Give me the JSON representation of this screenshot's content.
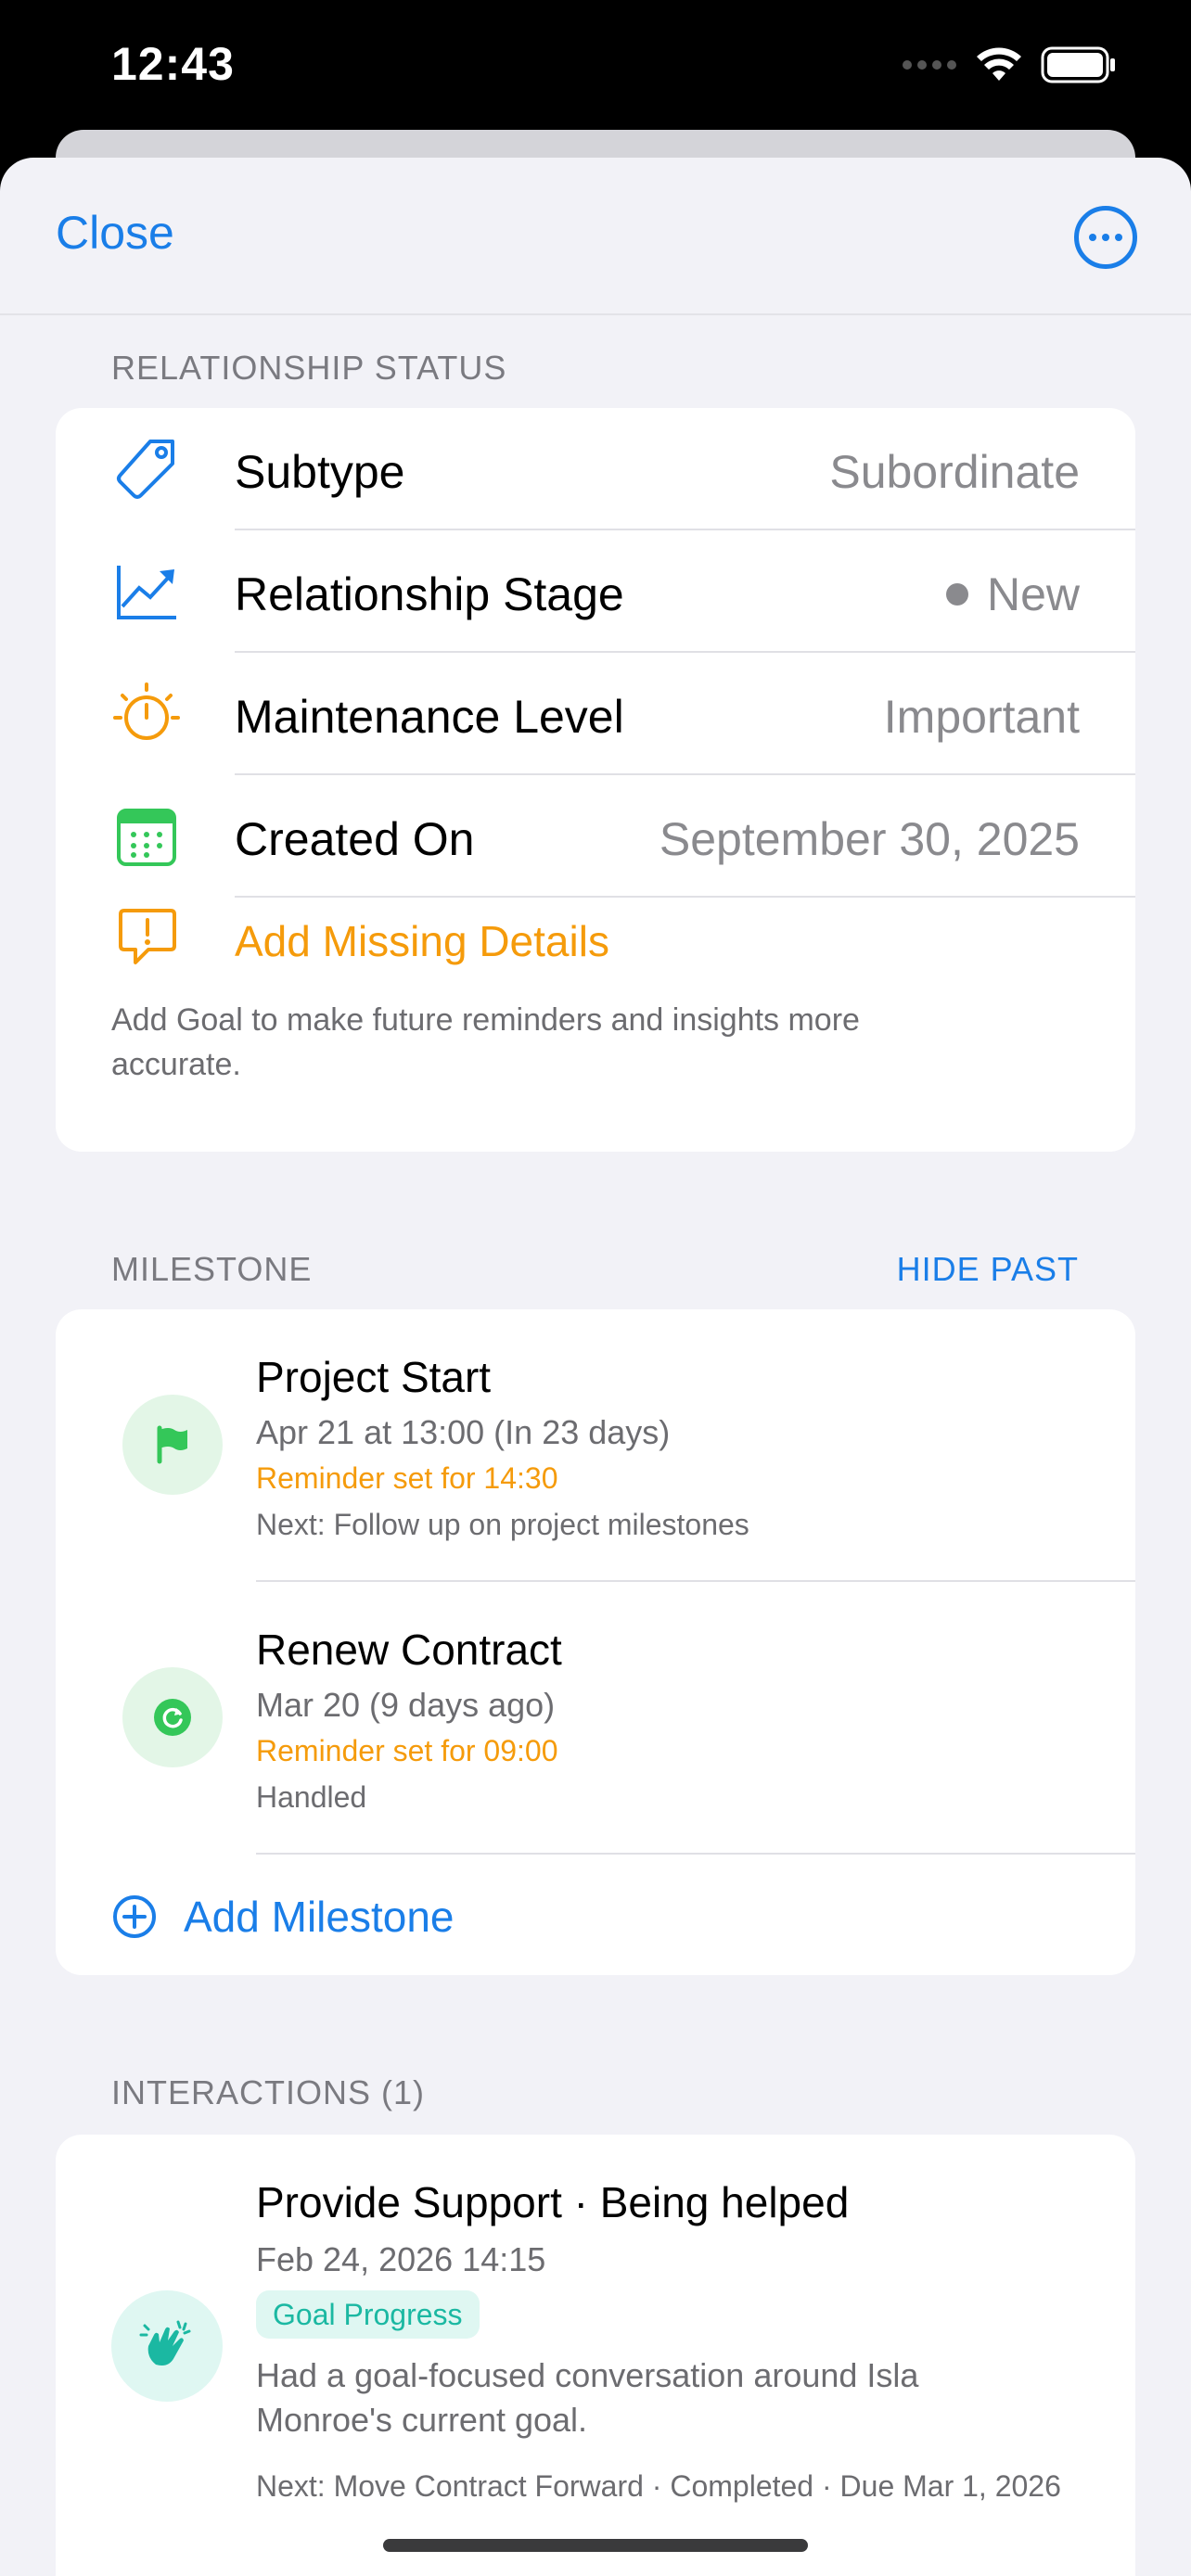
{
  "status_bar": {
    "time": "12:43"
  },
  "nav": {
    "close_label": "Close",
    "more_icon": "ellipsis-circle-icon"
  },
  "relationship": {
    "header": "RELATIONSHIP STATUS",
    "rows": [
      {
        "icon": "tag-icon",
        "label": "Subtype",
        "value": "Subordinate"
      },
      {
        "icon": "trend-chart-icon",
        "label": "Relationship Stage",
        "value": "New"
      },
      {
        "icon": "timer-icon",
        "label": "Maintenance Level",
        "value": "Important"
      },
      {
        "icon": "calendar-icon",
        "label": "Created On",
        "value": "September 30, 2025"
      }
    ],
    "missing": {
      "label": "Add Missing Details",
      "description": "Add Goal to make future reminders and insights more accurate."
    }
  },
  "milestone": {
    "header": "MILESTONE",
    "action": "HIDE PAST",
    "items": [
      {
        "icon": "flag-icon",
        "title": "Project Start",
        "date": "Apr 21 at 13:00 (In 23 days)",
        "reminder": "Reminder set for 14:30",
        "note": "Next: Follow up on project milestones"
      },
      {
        "icon": "refresh-icon",
        "title": "Renew Contract",
        "date": "Mar 20 (9 days ago)",
        "reminder": "Reminder set for 09:00",
        "note": "Handled"
      }
    ],
    "add_label": "Add Milestone"
  },
  "interactions": {
    "header": "INTERACTIONS (1)",
    "items": [
      {
        "icon": "clapping-hands-icon",
        "title": "Provide Support · Being helped",
        "date": "Feb 24, 2026 14:15",
        "tag": "Goal Progress",
        "description": "Had a goal-focused conversation around Isla Monroe's current goal.",
        "next": "Next: Move Contract Forward · Completed · Due Mar 1, 2026"
      }
    ]
  },
  "colors": {
    "accent_blue": "#1a7ee8",
    "warning_orange": "#f59b0b",
    "success_green": "#34c759",
    "teal": "#1bb8a2"
  }
}
